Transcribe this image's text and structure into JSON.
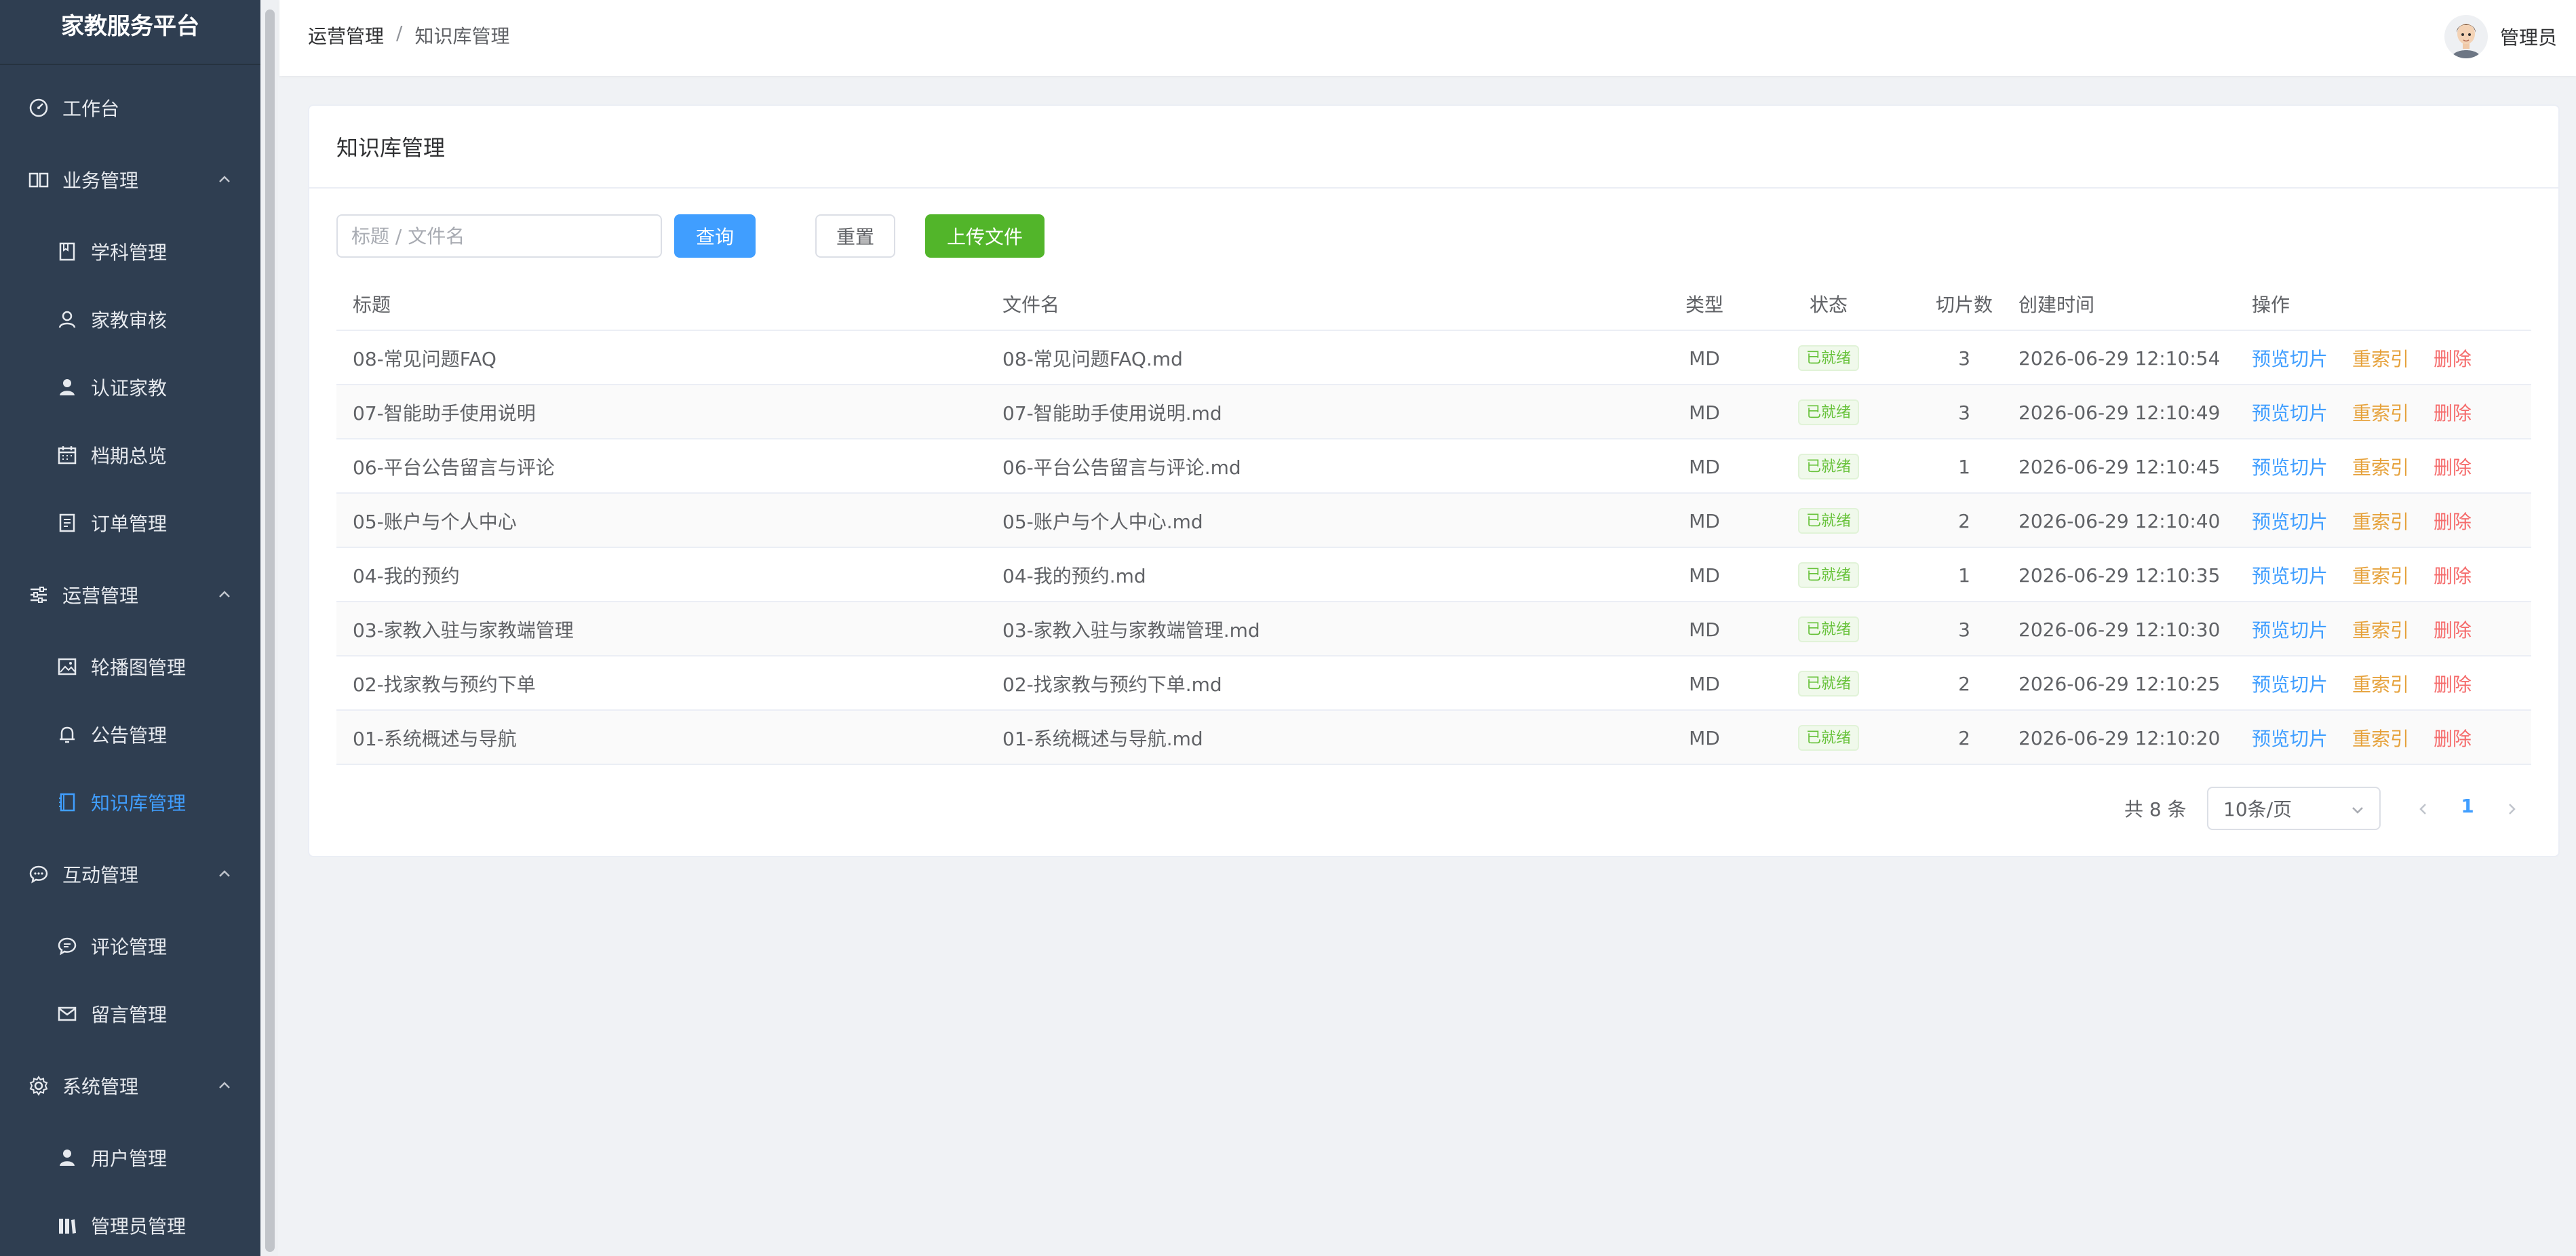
{
  "sidebar": {
    "title": "家教服务平台",
    "items": [
      {
        "label": "工作台",
        "icon": "dashboard-icon"
      },
      {
        "label": "业务管理",
        "icon": "book-icon"
      },
      {
        "label": "学科管理",
        "icon": "notebook-icon"
      },
      {
        "label": "家教审核",
        "icon": "user-outline-icon"
      },
      {
        "label": "认证家教",
        "icon": "user-filled-icon"
      },
      {
        "label": "档期总览",
        "icon": "calendar-icon"
      },
      {
        "label": "订单管理",
        "icon": "document-icon"
      },
      {
        "label": "运营管理",
        "icon": "sliders-icon"
      },
      {
        "label": "轮播图管理",
        "icon": "picture-icon"
      },
      {
        "label": "公告管理",
        "icon": "bell-icon"
      },
      {
        "label": "知识库管理",
        "icon": "notebook-icon"
      },
      {
        "label": "互动管理",
        "icon": "chat-icon"
      },
      {
        "label": "评论管理",
        "icon": "chat-icon"
      },
      {
        "label": "留言管理",
        "icon": "message-icon"
      },
      {
        "label": "系统管理",
        "icon": "gear-icon"
      },
      {
        "label": "用户管理",
        "icon": "user-filled-icon"
      },
      {
        "label": "管理员管理",
        "icon": "admin-icon"
      }
    ]
  },
  "header": {
    "breadcrumb": [
      "运营管理",
      "知识库管理"
    ],
    "separator": "/",
    "username": "管理员"
  },
  "card": {
    "title": "知识库管理",
    "search_placeholder": "标题 / 文件名",
    "query_label": "查询",
    "reset_label": "重置",
    "upload_label": "上传文件"
  },
  "table": {
    "columns": {
      "title": "标题",
      "file": "文件名",
      "type": "类型",
      "status": "状态",
      "chunks": "切片数",
      "time": "创建时间",
      "ops": "操作"
    },
    "ops": {
      "preview": "预览切片",
      "reindex": "重索引",
      "delete": "删除"
    },
    "rows": [
      {
        "title": "08-常见问题FAQ",
        "file": "08-常见问题FAQ.md",
        "type": "MD",
        "status": "已就绪",
        "chunks": "3",
        "time": "2026-06-29 12:10:54"
      },
      {
        "title": "07-智能助手使用说明",
        "file": "07-智能助手使用说明.md",
        "type": "MD",
        "status": "已就绪",
        "chunks": "3",
        "time": "2026-06-29 12:10:49"
      },
      {
        "title": "06-平台公告留言与评论",
        "file": "06-平台公告留言与评论.md",
        "type": "MD",
        "status": "已就绪",
        "chunks": "1",
        "time": "2026-06-29 12:10:45"
      },
      {
        "title": "05-账户与个人中心",
        "file": "05-账户与个人中心.md",
        "type": "MD",
        "status": "已就绪",
        "chunks": "2",
        "time": "2026-06-29 12:10:40"
      },
      {
        "title": "04-我的预约",
        "file": "04-我的预约.md",
        "type": "MD",
        "status": "已就绪",
        "chunks": "1",
        "time": "2026-06-29 12:10:35"
      },
      {
        "title": "03-家教入驻与家教端管理",
        "file": "03-家教入驻与家教端管理.md",
        "type": "MD",
        "status": "已就绪",
        "chunks": "3",
        "time": "2026-06-29 12:10:30"
      },
      {
        "title": "02-找家教与预约下单",
        "file": "02-找家教与预约下单.md",
        "type": "MD",
        "status": "已就绪",
        "chunks": "2",
        "time": "2026-06-29 12:10:25"
      },
      {
        "title": "01-系统概述与导航",
        "file": "01-系统概述与导航.md",
        "type": "MD",
        "status": "已就绪",
        "chunks": "2",
        "time": "2026-06-29 12:10:20"
      }
    ]
  },
  "pagination": {
    "total_text": "共 8 条",
    "page_size": "10条/页",
    "current_page": "1"
  },
  "colors": {
    "sidebar_bg": "#2f3e51",
    "accent": "#409eff",
    "success": "#67c23a",
    "warning": "#e6a23c",
    "danger": "#f56c6c",
    "upload_btn": "#52b52a"
  }
}
